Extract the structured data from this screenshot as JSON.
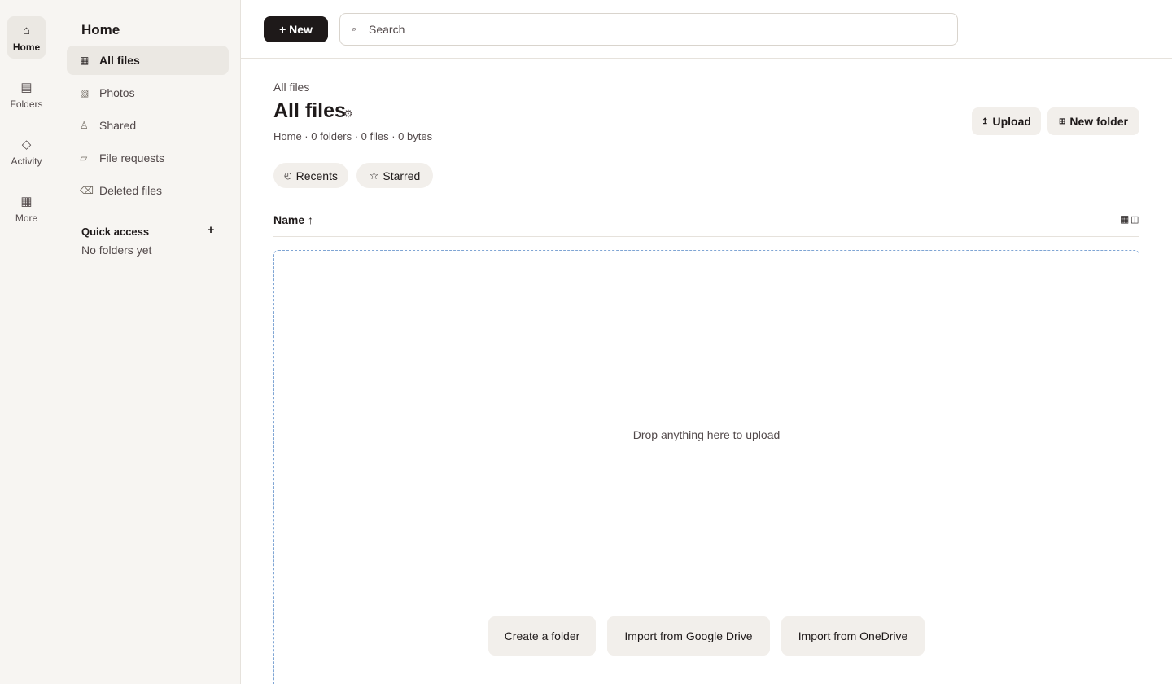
{
  "rail": {
    "items": [
      {
        "icon": "⌂",
        "label": "Home"
      },
      {
        "icon": "▤",
        "label": "Folders"
      },
      {
        "icon": "◇",
        "label": "Activity"
      },
      {
        "icon": "▦",
        "label": "More"
      }
    ]
  },
  "sidebar": {
    "title": "Home",
    "items": [
      {
        "icon": "▦",
        "label": "All files"
      },
      {
        "icon": "▧",
        "label": "Photos"
      },
      {
        "icon": "♙",
        "label": "Shared"
      },
      {
        "icon": "▱",
        "label": "File requests"
      },
      {
        "icon": "⌫",
        "label": "Deleted files"
      }
    ],
    "quick_access": {
      "title": "Quick access",
      "add": "+",
      "empty": "No folders yet"
    }
  },
  "topbar": {
    "new_label": "+ New",
    "search_icon": "⌕",
    "search_placeholder": "Search"
  },
  "main": {
    "breadcrumb": "All files",
    "title": "All files",
    "title_icon": "⚙",
    "meta": "Home · 0 folders · 0 files · 0 bytes",
    "upload": {
      "icon": "↥",
      "label": "Upload"
    },
    "new_folder": {
      "icon": "⊞",
      "label": "New folder"
    },
    "chips": [
      {
        "icon": "◴",
        "label": "Recents"
      },
      {
        "icon": "☆",
        "label": "Starred"
      }
    ],
    "sort_label": "Name ↑",
    "view_icons": {
      "grid": "▦",
      "list": "◫"
    },
    "dropzone": {
      "text": "Drop anything here to upload",
      "buttons": [
        "Create a folder",
        "Import from Google Drive",
        "Import from OneDrive"
      ]
    }
  }
}
